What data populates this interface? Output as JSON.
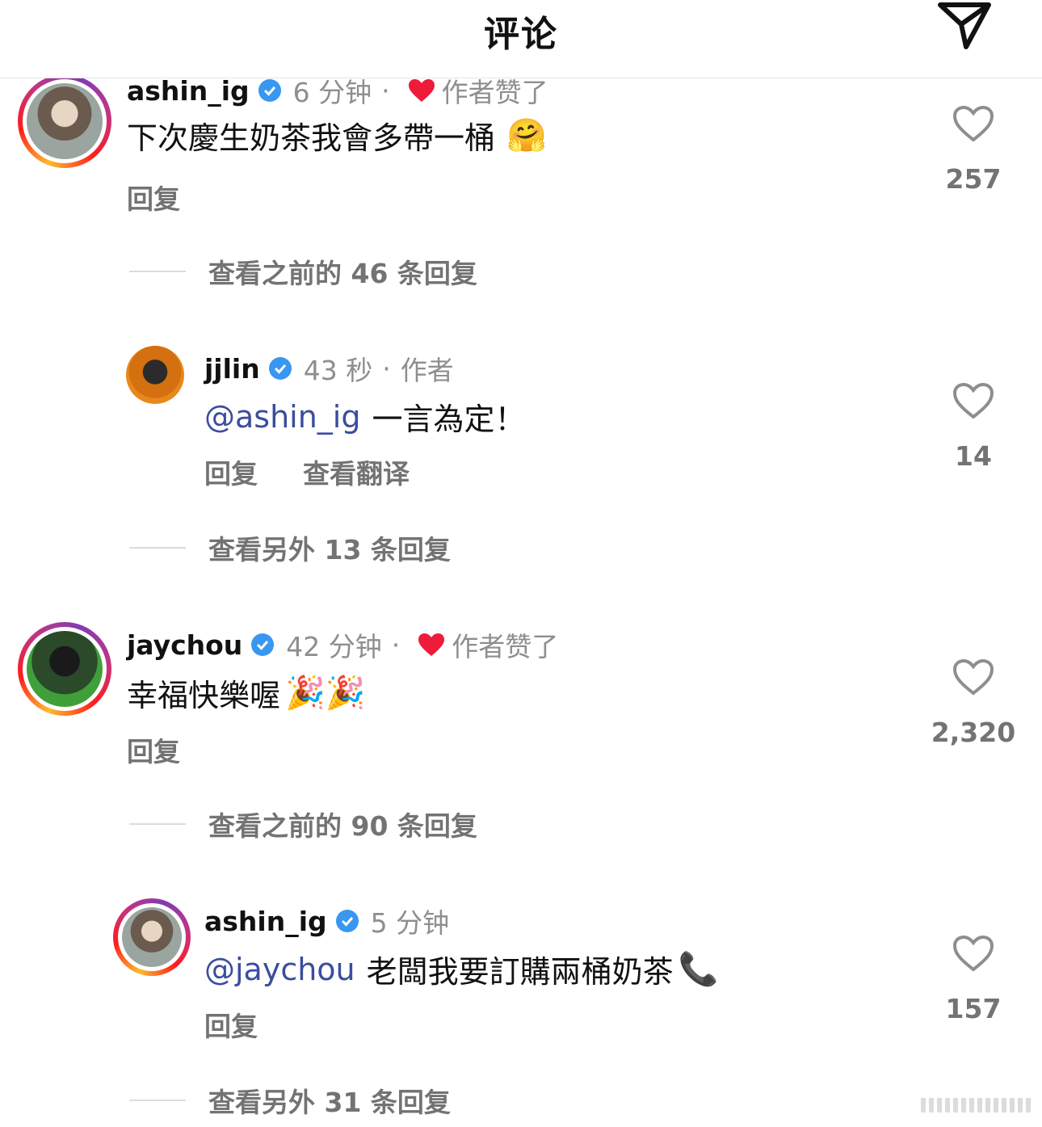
{
  "header": {
    "title": "评论"
  },
  "comments": [
    {
      "user": "ashin_ig",
      "time": "6 分钟",
      "sep": "·",
      "author_liked": "作者赞了",
      "text": "下次慶生奶茶我會多帶一桶",
      "emoji": "🤗",
      "reply": "回复",
      "likes": "257",
      "more_replies": "查看之前的 46 条回复"
    },
    {
      "user": "jjlin",
      "time": "43 秒",
      "sep": "·",
      "author_tag": "作者",
      "mention": "@ashin_ig",
      "text": "一言為定！",
      "reply": "回复",
      "translate": "查看翻译",
      "likes": "14",
      "more_replies": "查看另外 13 条回复"
    },
    {
      "user": "jaychou",
      "time": "42 分钟",
      "sep": "·",
      "author_liked": "作者赞了",
      "text": "幸福快樂喔",
      "emoji": "🎉🎉",
      "reply": "回复",
      "likes": "2,320",
      "more_replies": "查看之前的 90 条回复"
    },
    {
      "user": "ashin_ig",
      "time": "5 分钟",
      "mention": "@jaychou",
      "text": "老闆我要訂購兩桶奶茶",
      "emoji": "📞",
      "reply": "回复",
      "likes": "157",
      "more_replies": "查看另外 31 条回复"
    }
  ],
  "colors": {
    "mention": "#3b4d9e",
    "verified": "#3897f0",
    "heart_red": "#ed1c3a",
    "muted": "#8e8e8e"
  },
  "icons": [
    "share-icon",
    "verified-badge-icon",
    "heart-icon",
    "like-heart-icon"
  ]
}
